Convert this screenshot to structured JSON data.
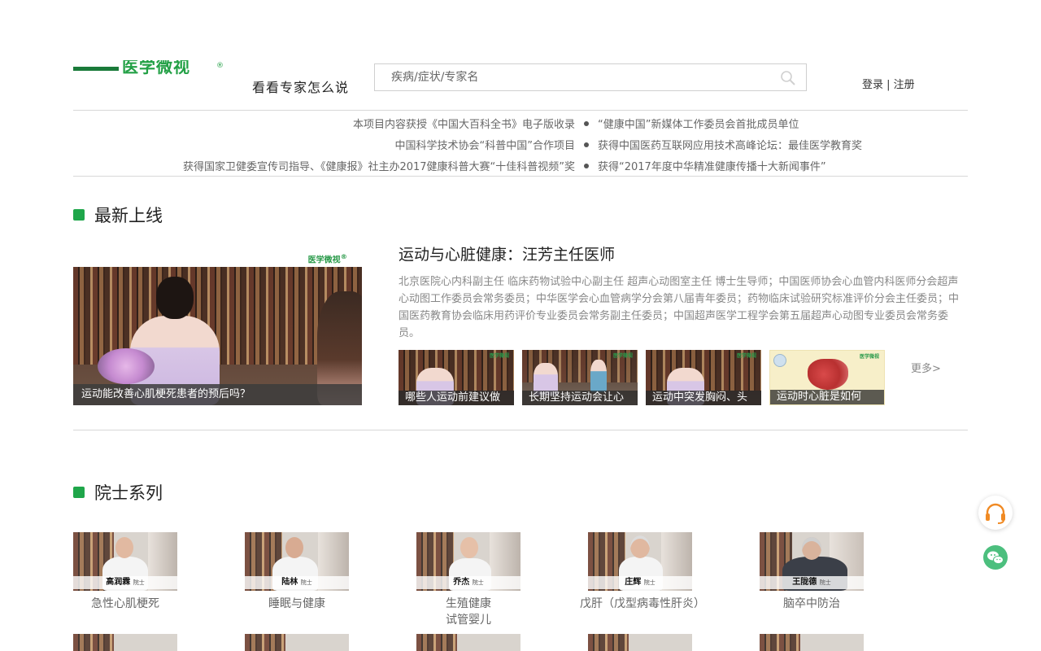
{
  "header": {
    "logo_text": "医学微视",
    "logo_reg": "®",
    "tagline": "看看专家怎么说",
    "search_placeholder": "疾病/症状/专家名",
    "login": "登录",
    "separator": " | ",
    "register": "注册"
  },
  "awards": [
    {
      "left": "本项目内容获授《中国大百科全书》电子版收录",
      "right": "“健康中国”新媒体工作委员会首批成员单位"
    },
    {
      "left": "中国科学技术协会“科普中国”合作项目",
      "right": "获得中国医药互联网应用技术高峰论坛：最佳医学教育奖"
    },
    {
      "left": "获得国家卫健委宣传司指导、《健康报》社主办2017健康科普大赛“十佳科普视频”奖",
      "right": "获得“2017年度中华精准健康传播十大新闻事件”"
    }
  ],
  "latest": {
    "section_title": "最新上线",
    "feature": {
      "logo": "医学微视",
      "caption": "运动能改善心肌梗死患者的预后吗？"
    },
    "title": "运动与心脏健康：汪芳主任医师",
    "description": "北京医院心内科副主任 临床药物试验中心副主任 超声心动图室主任 博士生导师；中国医师协会心血管内科医师分会超声心动图工作委员会常务委员；中华医学会心血管病学分会第八届青年委员；药物临床试验研究标准评价分会主任委员；中国医药教育协会临床用药评价专业委员会常务副主任委员；中国超声医学工程学会第五届超声心动图专业委员会常务委员。",
    "videos": [
      {
        "caption": "哪些人运动前建议做"
      },
      {
        "caption": "长期坚持运动会让心"
      },
      {
        "caption": "运动中突发胸闷、头"
      },
      {
        "caption": "运动时心脏是如何"
      }
    ],
    "more": "更多>"
  },
  "academician": {
    "section_title": "院士系列",
    "items": [
      {
        "name": "高润霖",
        "title_tag": "院士",
        "topic": "急性心肌梗死"
      },
      {
        "name": "陆林",
        "title_tag": "院士",
        "topic": "睡眠与健康"
      },
      {
        "name": "乔杰",
        "title_tag": "院士",
        "topic": "生殖健康\n试管婴儿"
      },
      {
        "name": "庄辉",
        "title_tag": "院士",
        "topic": "戊肝（戊型病毒性肝炎）"
      },
      {
        "name": "王陇德",
        "title_tag": "院士",
        "topic": "脑卒中防治"
      }
    ]
  },
  "colors": {
    "brand_green": "#1fa64a",
    "logo_green": "#22a045"
  },
  "icons": {
    "search": "search-icon",
    "service": "headset-icon",
    "wechat": "wechat-icon"
  }
}
